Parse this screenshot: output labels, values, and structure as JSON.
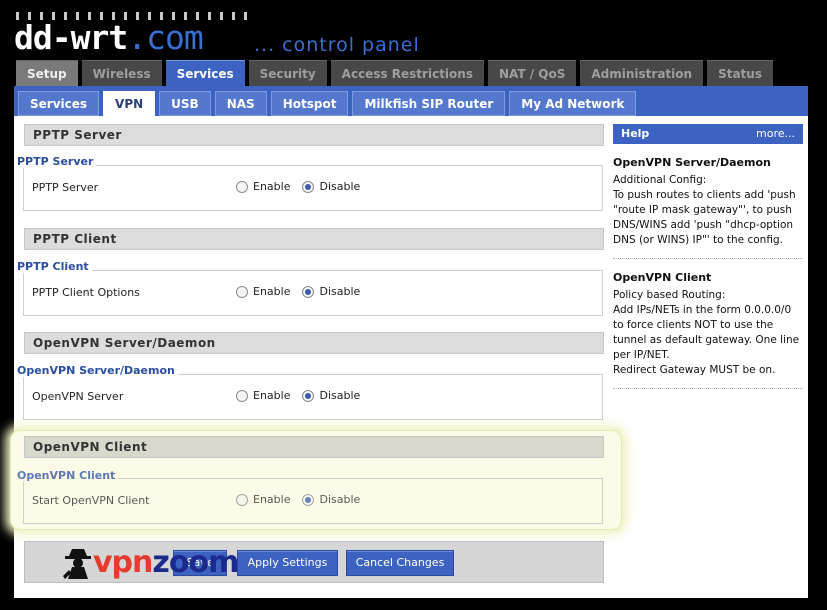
{
  "header": {
    "logo_main": "dd-wrt",
    "logo_dot": ".com",
    "subtitle": "... control panel"
  },
  "main_tabs": [
    {
      "label": "Setup"
    },
    {
      "label": "Wireless"
    },
    {
      "label": "Services"
    },
    {
      "label": "Security"
    },
    {
      "label": "Access Restrictions"
    },
    {
      "label": "NAT / QoS"
    },
    {
      "label": "Administration"
    },
    {
      "label": "Status"
    }
  ],
  "sub_tabs": [
    {
      "label": "Services"
    },
    {
      "label": "VPN"
    },
    {
      "label": "USB"
    },
    {
      "label": "NAS"
    },
    {
      "label": "Hotspot"
    },
    {
      "label": "Milkfish SIP Router"
    },
    {
      "label": "My Ad Network"
    }
  ],
  "sections": [
    {
      "header": "PPTP Server",
      "legend": "PPTP Server",
      "row_label": "PPTP Server",
      "enable_label": "Enable",
      "disable_label": "Disable",
      "selected": "Disable"
    },
    {
      "header": "PPTP Client",
      "legend": "PPTP Client",
      "row_label": "PPTP Client Options",
      "enable_label": "Enable",
      "disable_label": "Disable",
      "selected": "Disable"
    },
    {
      "header": "OpenVPN Server/Daemon",
      "legend": "OpenVPN Server/Daemon",
      "row_label": "OpenVPN Server",
      "enable_label": "Enable",
      "disable_label": "Disable",
      "selected": "Disable"
    },
    {
      "header": "OpenVPN Client",
      "legend": "OpenVPN Client",
      "row_label": "Start OpenVPN Client",
      "enable_label": "Enable",
      "disable_label": "Disable",
      "selected": "Disable"
    }
  ],
  "buttons": {
    "save": "Save",
    "apply": "Apply Settings",
    "cancel": "Cancel Changes"
  },
  "watermark": {
    "part1": "vpn",
    "part2": "zoom"
  },
  "help": {
    "title": "Help",
    "more": "more...",
    "entries": [
      {
        "title": "OpenVPN Server/Daemon",
        "text": "Additional Config:\nTo push routes to clients add 'push \"route IP mask gateway\"', to push DNS/WINS add 'push \"dhcp-option DNS (or WINS) IP\"' to the config."
      },
      {
        "title": "OpenVPN Client",
        "text": "Policy based Routing:\nAdd IPs/NETs in the form 0.0.0.0/0 to force clients NOT to use the tunnel as default gateway. One line per IP/NET.\nRedirect Gateway MUST be on."
      }
    ]
  },
  "colors": {
    "accent": "#3c63c2",
    "highlight": "#fbfbe8"
  }
}
